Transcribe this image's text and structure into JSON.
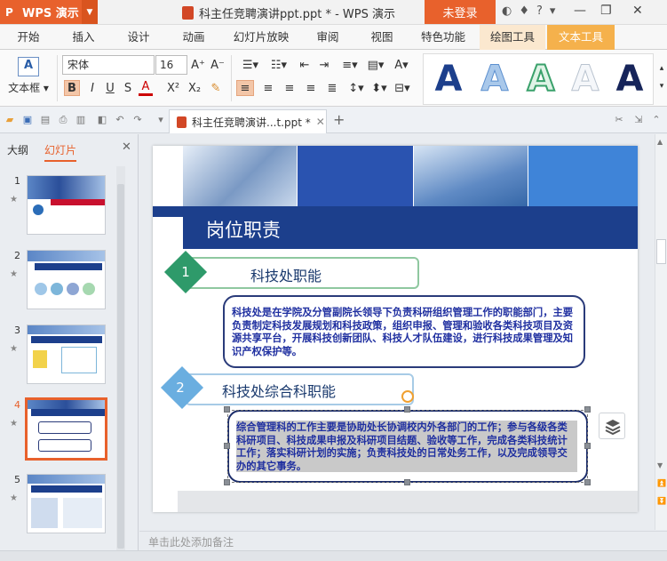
{
  "app": {
    "name": "WPS 演示",
    "window_title": "科主任竞聘演讲ppt.ppt * - WPS 演示",
    "login_label": "未登录"
  },
  "ribbon_tabs": [
    "开始",
    "插入",
    "设计",
    "动画",
    "幻灯片放映",
    "审阅",
    "视图",
    "特色功能",
    "绘图工具",
    "文本工具"
  ],
  "ribbon": {
    "textbox_label": "文本框",
    "font_name": "宋体",
    "font_size": "16",
    "bold": "B",
    "italic": "I",
    "underline": "U",
    "strike": "S",
    "font_color": "A",
    "superscript": "X²",
    "subscript": "X₂",
    "grow_font": "A⁺",
    "shrink_font": "A⁻",
    "art_letter": "A"
  },
  "document_tab": {
    "title": "科主任竞聘演讲...t.ppt *"
  },
  "left_panel": {
    "tab_outline": "大纲",
    "tab_slides": "幻灯片",
    "thumbnails": [
      {
        "num": "1",
        "active": false
      },
      {
        "num": "2",
        "active": false
      },
      {
        "num": "3",
        "active": false
      },
      {
        "num": "4",
        "active": true
      },
      {
        "num": "5",
        "active": false
      }
    ]
  },
  "slide": {
    "title": "岗位职责",
    "section1": {
      "num": "1",
      "heading": "科技处职能",
      "body": "科技处是在学院及分管副院长领导下负责科研组织管理工作的职能部门，主要负责制定科技发展规划和科技政策，组织申报、管理和验收各类科技项目及资源共享平台，开展科技创新团队、科技人才队伍建设，进行科技成果管理及知识产权保护等。"
    },
    "section2": {
      "num": "2",
      "heading": "科技处综合科职能",
      "body": "综合管理科的工作主要是协助处长协调校内外各部门的工作；参与各级各类科研项目、科技成果申报及科研项目结题、验收等工作，完成各类科技统计工作；落实科研计划的实施；负责科技处的日常处务工作，以及完成领导交办的其它事务。"
    }
  },
  "notes_placeholder": "单击此处添加备注",
  "colors": {
    "accent": "#e8612c",
    "title_bar": "#1c3f8c",
    "section_green": "#2e9a6a",
    "section_blue": "#6aaee0",
    "body_text": "#1f2fa0"
  }
}
